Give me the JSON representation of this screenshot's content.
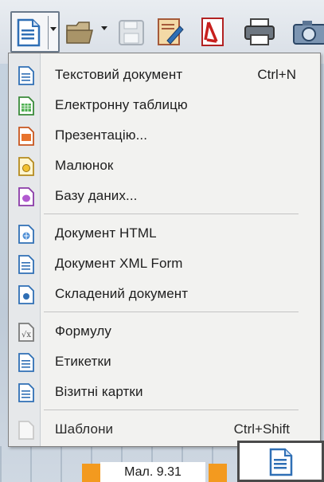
{
  "menu": {
    "items": [
      {
        "label": "Текстовий документ",
        "shortcut": "Ctrl+N",
        "icon": "writer-document-icon"
      },
      {
        "label": "Електронну таблицю",
        "shortcut": "",
        "icon": "calc-spreadsheet-icon"
      },
      {
        "label": "Презентацію...",
        "shortcut": "",
        "icon": "impress-presentation-icon"
      },
      {
        "label": "Малюнок",
        "shortcut": "",
        "icon": "draw-drawing-icon"
      },
      {
        "label": "Базу даних...",
        "shortcut": "",
        "icon": "base-database-icon"
      },
      {
        "label": "Документ HTML",
        "shortcut": "",
        "icon": "html-document-icon"
      },
      {
        "label": "Документ XML Form",
        "shortcut": "",
        "icon": "xml-form-document-icon"
      },
      {
        "label": "Складений документ",
        "shortcut": "",
        "icon": "master-document-icon"
      },
      {
        "label": "Формулу",
        "shortcut": "",
        "icon": "math-formula-icon"
      },
      {
        "label": "Етикетки",
        "shortcut": "",
        "icon": "labels-icon"
      },
      {
        "label": "Візитні картки",
        "shortcut": "",
        "icon": "business-cards-icon"
      },
      {
        "label": "Шаблони",
        "shortcut": "Ctrl+Shift",
        "icon": "templates-icon"
      }
    ]
  },
  "toolbar": {
    "buttons": [
      "new-document-icon",
      "open-folder-icon",
      "save-icon",
      "edit-document-icon",
      "export-pdf-icon",
      "print-icon",
      "camera-icon"
    ]
  },
  "caption": {
    "text": "Мал. 9.31"
  },
  "colors": {
    "accent": "#f39a1f",
    "menu_bg": "#f2f2f0",
    "doc_blue": "#2f6fb5"
  }
}
